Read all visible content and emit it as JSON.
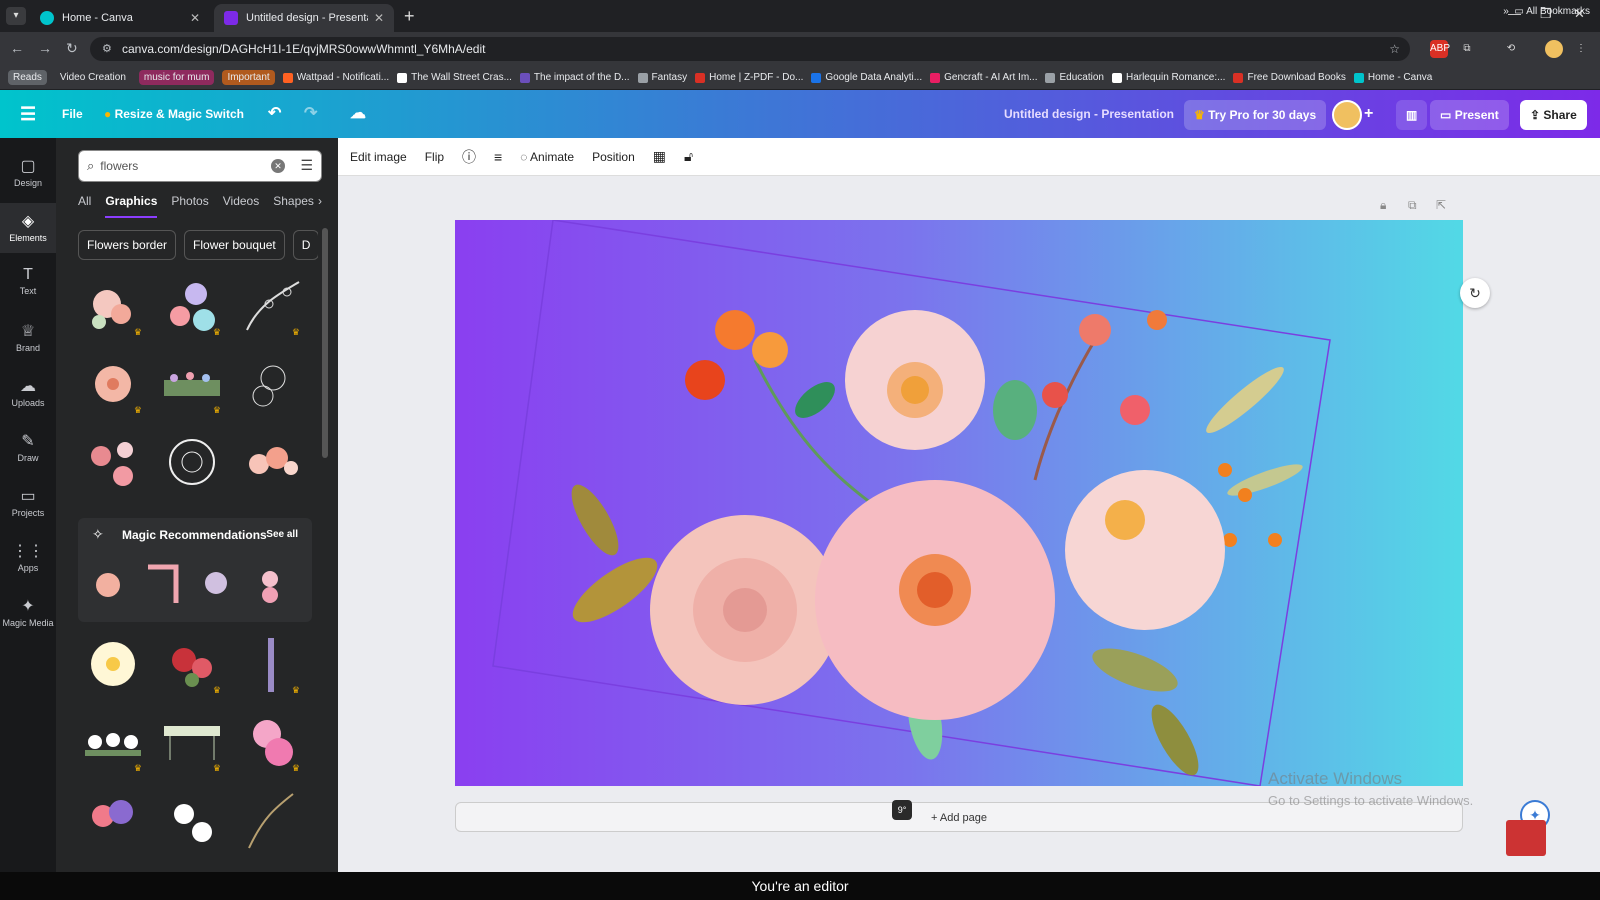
{
  "browser": {
    "tabs": [
      {
        "title": "Home - Canva"
      },
      {
        "title": "Untitled design - Presentation"
      }
    ],
    "url": "canva.com/design/DAGHcH1I-1E/qvjMRS0owwWhmntl_Y6MhA/edit",
    "bookmarks": [
      {
        "label": "Reads",
        "color": "#5f6368"
      },
      {
        "label": "Video Creation",
        "color": ""
      },
      {
        "label": "music for mum",
        "color": "#8e2a5e"
      },
      {
        "label": "Important",
        "color": "#b05a1e"
      },
      {
        "label": "Wattpad - Notificati...",
        "color": "#ff6122"
      },
      {
        "label": "The Wall Street Cras...",
        "color": "#ffffff"
      },
      {
        "label": "The impact of the D...",
        "color": "#6b4fbb"
      },
      {
        "label": "Fantasy",
        "color": "#9aa0a6"
      },
      {
        "label": "Home | Z-PDF - Do...",
        "color": "#d93025"
      },
      {
        "label": "Google Data Analyti...",
        "color": "#1a73e8"
      },
      {
        "label": "Gencraft - AI Art Im...",
        "color": "#e91e63"
      },
      {
        "label": "Education",
        "color": "#9aa0a6"
      },
      {
        "label": "Harlequin Romance:...",
        "color": "#ffffff"
      },
      {
        "label": "Free Download Books",
        "color": "#d93025"
      },
      {
        "label": "Home - Canva",
        "color": "#00c4cc"
      }
    ],
    "all_bookmarks": "All Bookmarks"
  },
  "header": {
    "file": "File",
    "resize": "Resize & Magic Switch",
    "doc_title": "Untitled design - Presentation",
    "try_pro": "Try Pro for 30 days",
    "present": "Present",
    "share": "Share"
  },
  "rail": [
    {
      "label": "Design",
      "icon": "design-icon"
    },
    {
      "label": "Elements",
      "icon": "elements-icon"
    },
    {
      "label": "Text",
      "icon": "text-icon"
    },
    {
      "label": "Brand",
      "icon": "brand-icon"
    },
    {
      "label": "Uploads",
      "icon": "uploads-icon"
    },
    {
      "label": "Draw",
      "icon": "draw-icon"
    },
    {
      "label": "Projects",
      "icon": "projects-icon"
    },
    {
      "label": "Apps",
      "icon": "apps-icon"
    },
    {
      "label": "Magic Media",
      "icon": "magic-media-icon"
    }
  ],
  "panel": {
    "search_value": "flowers",
    "tabs": [
      "All",
      "Graphics",
      "Photos",
      "Videos",
      "Shapes"
    ],
    "chips": [
      "Flowers border",
      "Flower bouquet",
      "D"
    ],
    "magic_title": "Magic Recommendations",
    "see_all": "See all"
  },
  "toolbar": {
    "edit_image": "Edit image",
    "flip": "Flip",
    "animate": "Animate",
    "position": "Position"
  },
  "canvas": {
    "add_page": "+ Add page",
    "page_badge": "9°"
  },
  "watermark": {
    "line1": "Activate Windows",
    "line2": "Go to Settings to activate Windows."
  },
  "status": "You're an editor",
  "colors": {
    "accent": "#8b3dff",
    "gradient_start": "#8a3ff0",
    "gradient_end": "#52d9e6"
  }
}
